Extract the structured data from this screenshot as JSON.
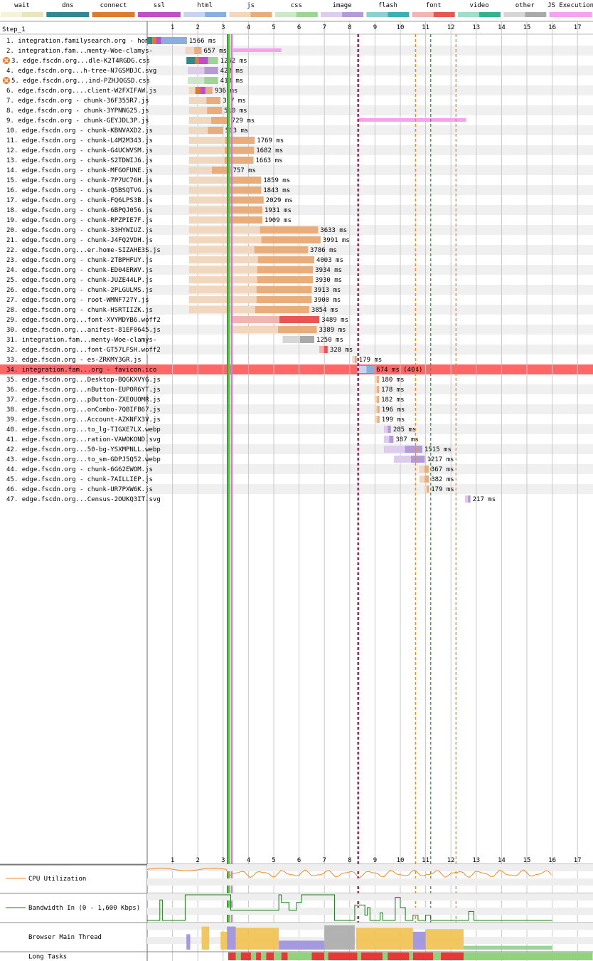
{
  "step_label": "Step_1",
  "legend": [
    {
      "label": "wait",
      "light": "#f6f3da",
      "dark": "#e8e4c0"
    },
    {
      "label": "dns",
      "light": "#2f8a8e",
      "dark": "#2f8a8e"
    },
    {
      "label": "connect",
      "light": "#e07a2c",
      "dark": "#e07a2c"
    },
    {
      "label": "ssl",
      "light": "#c44bc9",
      "dark": "#c44bc9"
    },
    {
      "label": "html",
      "light": "#c5d5ee",
      "dark": "#8aaede"
    },
    {
      "label": "js",
      "light": "#f0d7bf",
      "dark": "#e8ad7a"
    },
    {
      "label": "css",
      "light": "#cce8c8",
      "dark": "#9fd497"
    },
    {
      "label": "image",
      "light": "#ddccec",
      "dark": "#b59ad8"
    },
    {
      "label": "flash",
      "light": "#8fcfcf",
      "dark": "#3bb0b0"
    },
    {
      "label": "font",
      "light": "#f2b3b3",
      "dark": "#e85555"
    },
    {
      "label": "video",
      "light": "#a2dcc9",
      "dark": "#33b38e"
    },
    {
      "label": "other",
      "light": "#d6d6d6",
      "dark": "#aaaaaa"
    },
    {
      "label": "JS Execution",
      "light": "#f5a3ef",
      "dark": "#f5a3ef"
    }
  ],
  "chart_data": {
    "type": "waterfall",
    "x_unit": "seconds",
    "x_ticks": [
      1,
      2,
      3,
      4,
      5,
      6,
      7,
      8,
      9,
      10,
      11,
      12,
      13,
      14,
      15,
      16,
      17
    ],
    "x_range": [
      0,
      17.5
    ],
    "markers": [
      {
        "kind": "start-render",
        "t": 3.18,
        "color": "#2ea82e"
      },
      {
        "kind": "first-contentful-paint",
        "t": 3.24,
        "color": "#66cc33"
      },
      {
        "kind": "dom-interactive",
        "t": 3.34,
        "color": "#d07ad9"
      },
      {
        "kind": "dom-content-loaded",
        "t": 8.32,
        "color": "#3333cc"
      },
      {
        "kind": "on-load-dashed",
        "t": 8.35,
        "color": "#cc2222"
      },
      {
        "kind": "on-load",
        "t": 10.6,
        "color": "#f08a2c"
      },
      {
        "kind": "visually-complete",
        "t": 11.2,
        "color": "#33aa33"
      },
      {
        "kind": "fully-loaded",
        "t": 12.2,
        "color": "#f08a2c"
      }
    ],
    "requests": [
      {
        "n": 1,
        "label": "integration.familysearch.org - home",
        "start": 0.0,
        "dur": "1566 ms",
        "end": 1.57,
        "type": "html",
        "phases": [
          {
            "t": "dns",
            "s": 0.0,
            "e": 0.2
          },
          {
            "t": "connect",
            "s": 0.2,
            "e": 0.35
          },
          {
            "t": "ssl",
            "s": 0.35,
            "e": 0.55
          }
        ],
        "ttfb": 0.55
      },
      {
        "n": 2,
        "label": "integration.fam...menty-Woe-clamys-",
        "start": 1.5,
        "dur": "657 ms",
        "end": 2.15,
        "type": "js"
      },
      {
        "n": 3,
        "label": "edge.fscdn.org...dle-K2T4RGDG.css",
        "start": 1.55,
        "dur": "1252 ms",
        "end": 2.8,
        "type": "css",
        "blocking": true,
        "phases": [
          {
            "t": "dns",
            "s": 1.55,
            "e": 1.9
          },
          {
            "t": "connect",
            "s": 1.9,
            "e": 2.05
          },
          {
            "t": "ssl",
            "s": 2.05,
            "e": 2.4
          }
        ],
        "ttfb": 2.4
      },
      {
        "n": 4,
        "label": "edge.fscdn.org...h-tree-N7GSMDJC.svg",
        "start": 1.6,
        "dur": "423 ms",
        "end": 2.8,
        "type": "image"
      },
      {
        "n": 5,
        "label": "edge.fscdn.org...ind-PZHJQGSD.css",
        "start": 1.6,
        "dur": "413 ms",
        "end": 2.8,
        "type": "css",
        "blocking": true
      },
      {
        "n": 6,
        "label": "edge.fscdn.org....client-W2FXIFAW.js",
        "start": 1.65,
        "dur": "936 ms",
        "end": 2.58,
        "type": "js",
        "phases": [
          {
            "t": "connect",
            "s": 1.9,
            "e": 2.1
          },
          {
            "t": "ssl",
            "s": 2.1,
            "e": 2.3
          }
        ],
        "ttfb": 2.3
      },
      {
        "n": 7,
        "label": "edge.fscdn.org - chunk-36F355R7.js",
        "start": 1.65,
        "dur": "367 ms",
        "end": 2.9,
        "type": "js"
      },
      {
        "n": 8,
        "label": "edge.fscdn.org - chunk-3YPNNG25.js",
        "start": 1.65,
        "dur": "510 ms",
        "end": 2.95,
        "type": "js"
      },
      {
        "n": 9,
        "label": "edge.fscdn.org - chunk-GEYJDL3P.js",
        "start": 1.65,
        "dur": "729 ms",
        "end": 3.25,
        "type": "js"
      },
      {
        "n": 10,
        "label": "edge.fscdn.org - chunk-KBNVAXD2.js",
        "start": 1.65,
        "dur": "503 ms",
        "end": 3.0,
        "type": "js"
      },
      {
        "n": 11,
        "label": "edge.fscdn.org - chunk-L4M2M343.js",
        "start": 1.65,
        "dur": "1769 ms",
        "end": 4.25,
        "type": "js"
      },
      {
        "n": 12,
        "label": "edge.fscdn.org - chunk-G4UCWVSM.js",
        "start": 1.65,
        "dur": "1682 ms",
        "end": 4.22,
        "type": "js"
      },
      {
        "n": 13,
        "label": "edge.fscdn.org - chunk-S2TDWIJ6.js",
        "start": 1.65,
        "dur": "1663 ms",
        "end": 4.2,
        "type": "js"
      },
      {
        "n": 14,
        "label": "edge.fscdn.org - chunk-MFGOFUNE.js",
        "start": 1.65,
        "dur": "757 ms",
        "end": 3.3,
        "type": "js"
      },
      {
        "n": 15,
        "label": "edge.fscdn.org - chunk-7P7UC76H.js",
        "start": 1.65,
        "dur": "1859 ms",
        "end": 4.5,
        "type": "js"
      },
      {
        "n": 16,
        "label": "edge.fscdn.org - chunk-Q5BSQTVG.js",
        "start": 1.65,
        "dur": "1843 ms",
        "end": 4.5,
        "type": "js"
      },
      {
        "n": 17,
        "label": "edge.fscdn.org - chunk-FQ6LPS3B.js",
        "start": 1.65,
        "dur": "2029 ms",
        "end": 4.6,
        "type": "js"
      },
      {
        "n": 18,
        "label": "edge.fscdn.org - chunk-6BPQJ056.js",
        "start": 1.65,
        "dur": "1931 ms",
        "end": 4.55,
        "type": "js"
      },
      {
        "n": 19,
        "label": "edge.fscdn.org - chunk-RPZPIE7F.js",
        "start": 1.65,
        "dur": "1909 ms",
        "end": 4.55,
        "type": "js"
      },
      {
        "n": 20,
        "label": "edge.fscdn.org - chunk-33HYWIUZ.js",
        "start": 1.65,
        "dur": "3633 ms",
        "end": 6.75,
        "type": "js"
      },
      {
        "n": 21,
        "label": "edge.fscdn.org - chunk-J4FQ2VDH.js",
        "start": 1.65,
        "dur": "3991 ms",
        "end": 6.85,
        "type": "js"
      },
      {
        "n": 22,
        "label": "edge.fscdn.org...er.home-SIZAHE3S.js",
        "start": 1.65,
        "dur": "3786 ms",
        "end": 6.35,
        "type": "js"
      },
      {
        "n": 23,
        "label": "edge.fscdn.org - chunk-2TBPHFUY.js",
        "start": 1.65,
        "dur": "4003 ms",
        "end": 6.6,
        "type": "js"
      },
      {
        "n": 24,
        "label": "edge.fscdn.org - chunk-ED04ERWV.js",
        "start": 1.65,
        "dur": "3934 ms",
        "end": 6.55,
        "type": "js"
      },
      {
        "n": 25,
        "label": "edge.fscdn.org - chunk-JUZE44LP.js",
        "start": 1.65,
        "dur": "3930 ms",
        "end": 6.55,
        "type": "js"
      },
      {
        "n": 26,
        "label": "edge.fscdn.org - chunk-2PLGULMS.js",
        "start": 1.65,
        "dur": "3913 ms",
        "end": 6.5,
        "type": "js"
      },
      {
        "n": 27,
        "label": "edge.fscdn.org - root-WMNF727Y.js",
        "start": 1.65,
        "dur": "3900 ms",
        "end": 6.5,
        "type": "js"
      },
      {
        "n": 28,
        "label": "edge.fscdn.org - chunk-HSRTIIZK.js",
        "start": 1.65,
        "dur": "3854 ms",
        "end": 6.4,
        "type": "js"
      },
      {
        "n": 29,
        "label": "edge.fscdn.org...font-XVYMDYB6.woff2",
        "start": 3.3,
        "dur": "3489 ms",
        "end": 6.8,
        "type": "font"
      },
      {
        "n": 30,
        "label": "edge.fscdn.org...anifest-81EF0645.js",
        "start": 3.3,
        "dur": "3389 ms",
        "end": 6.7,
        "type": "js"
      },
      {
        "n": 31,
        "label": "integration.fam...menty-Woe-clamys-",
        "start": 5.35,
        "dur": "1250 ms",
        "end": 6.6,
        "type": "other"
      },
      {
        "n": 32,
        "label": "edge.fscdn.org...font-GT57LFSH.woff2",
        "start": 6.8,
        "dur": "328 ms",
        "end": 7.13,
        "type": "font"
      },
      {
        "n": 33,
        "label": "edge.fscdn.org - es-ZRKMY3GR.js",
        "start": 8.1,
        "dur": "179 ms",
        "end": 8.28,
        "type": "js"
      },
      {
        "n": 34,
        "label": "integration.fam...org - favicon.ico",
        "start": 8.3,
        "dur": "674 ms (404)",
        "end": 8.97,
        "type": "html",
        "error": true
      },
      {
        "n": 35,
        "label": "edge.fscdn.org...Desktop-BQGKXVYG.js",
        "start": 8.98,
        "dur": "180 ms",
        "end": 9.16,
        "type": "js"
      },
      {
        "n": 36,
        "label": "edge.fscdn.org...nButton-EUPOR6YT.js",
        "start": 8.98,
        "dur": "178 ms",
        "end": 9.16,
        "type": "js"
      },
      {
        "n": 37,
        "label": "edge.fscdn.org...pButton-ZXEOUOMR.js",
        "start": 8.98,
        "dur": "182 ms",
        "end": 9.16,
        "type": "js"
      },
      {
        "n": 38,
        "label": "edge.fscdn.org...onCombo-7QBIFB67.js",
        "start": 8.98,
        "dur": "196 ms",
        "end": 9.18,
        "type": "js"
      },
      {
        "n": 39,
        "label": "edge.fscdn.org...Account-AZKNFX3V.js",
        "start": 8.98,
        "dur": "199 ms",
        "end": 9.18,
        "type": "js"
      },
      {
        "n": 40,
        "label": "edge.fscdn.org...to_lg-TIGXE7LX.webp",
        "start": 9.35,
        "dur": "285 ms",
        "end": 9.63,
        "type": "image"
      },
      {
        "n": 41,
        "label": "edge.fscdn.org...ration-VAWOKOND.svg",
        "start": 9.35,
        "dur": "387 ms",
        "end": 9.73,
        "type": "image"
      },
      {
        "n": 42,
        "label": "edge.fscdn.org...50-bg-YSXMPNLL.webp",
        "start": 9.35,
        "dur": "1515 ms",
        "end": 10.87,
        "type": "image"
      },
      {
        "n": 43,
        "label": "edge.fscdn.org...to_sm-GDPJ5Q52.webp",
        "start": 9.75,
        "dur": "1217 ms",
        "end": 10.97,
        "type": "image"
      },
      {
        "n": 44,
        "label": "edge.fscdn.org - chunk-6G62EWOM.js",
        "start": 10.75,
        "dur": "367 ms",
        "end": 11.12,
        "type": "js"
      },
      {
        "n": 45,
        "label": "edge.fscdn.org - chunk-7AILLIEP.js",
        "start": 10.75,
        "dur": "382 ms",
        "end": 11.13,
        "type": "js"
      },
      {
        "n": 46,
        "label": "edge.fscdn.org - chunk-UR7PXW6K.js",
        "start": 10.95,
        "dur": "179 ms",
        "end": 11.13,
        "type": "js"
      },
      {
        "n": 47,
        "label": "edge.fscdn.org...Census-2OUKQ3IT.svg",
        "start": 12.55,
        "dur": "217 ms",
        "end": 12.77,
        "type": "image"
      }
    ],
    "js_execution": [
      {
        "row": 2,
        "s": 3.4,
        "e": 5.3
      },
      {
        "row": 9,
        "s": 8.35,
        "e": 12.6
      }
    ],
    "bottom_panels": [
      {
        "label": "CPU Utilization",
        "color": "#f08a2c"
      },
      {
        "label": "Bandwidth In (0 - 1,600 Kbps)",
        "color": "#1a7a1a"
      },
      {
        "label": "Browser Main Thread",
        "color": "#f2c14e"
      },
      {
        "label": "Long Tasks",
        "color": "#e53935"
      }
    ],
    "long_tasks": [
      {
        "s": 3.2,
        "e": 3.5,
        "kind": "long"
      },
      {
        "s": 3.5,
        "e": 3.7,
        "kind": "ok"
      },
      {
        "s": 3.7,
        "e": 4.1,
        "kind": "long"
      },
      {
        "s": 4.1,
        "e": 4.3,
        "kind": "ok"
      },
      {
        "s": 4.3,
        "e": 4.5,
        "kind": "long"
      },
      {
        "s": 4.5,
        "e": 4.7,
        "kind": "ok"
      },
      {
        "s": 4.7,
        "e": 5.0,
        "kind": "long"
      },
      {
        "s": 5.0,
        "e": 5.3,
        "kind": "ok"
      },
      {
        "s": 5.3,
        "e": 5.55,
        "kind": "long"
      },
      {
        "s": 5.55,
        "e": 6.5,
        "kind": "ok"
      },
      {
        "s": 6.5,
        "e": 7.0,
        "kind": "long"
      },
      {
        "s": 7.0,
        "e": 7.15,
        "kind": "ok"
      },
      {
        "s": 7.15,
        "e": 8.3,
        "kind": "long"
      },
      {
        "s": 8.3,
        "e": 8.45,
        "kind": "ok"
      },
      {
        "s": 8.45,
        "e": 9.3,
        "kind": "long"
      },
      {
        "s": 9.3,
        "e": 9.5,
        "kind": "ok"
      },
      {
        "s": 9.5,
        "e": 10.35,
        "kind": "long"
      },
      {
        "s": 10.35,
        "e": 10.5,
        "kind": "ok"
      },
      {
        "s": 10.5,
        "e": 11.3,
        "kind": "long"
      },
      {
        "s": 11.3,
        "e": 11.6,
        "kind": "ok"
      },
      {
        "s": 11.6,
        "e": 12.5,
        "kind": "long"
      },
      {
        "s": 12.5,
        "e": 17.6,
        "kind": "ok"
      }
    ]
  }
}
